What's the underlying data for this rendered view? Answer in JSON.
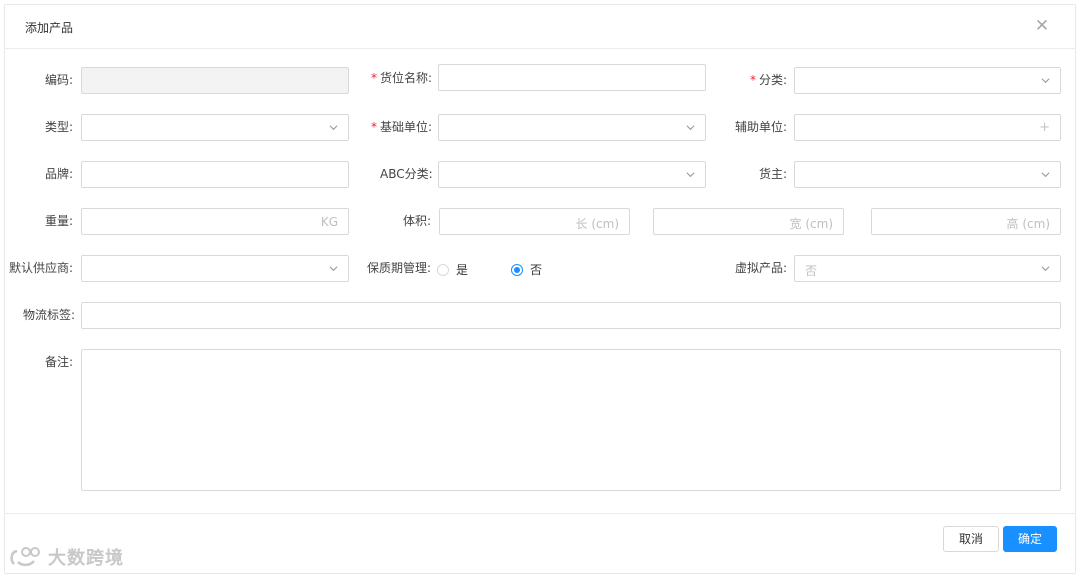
{
  "modal": {
    "title": "添加产品",
    "close_icon": "close-icon"
  },
  "form": {
    "code": {
      "label": "编码:",
      "value": ""
    },
    "location_name": {
      "label": "货位名称:",
      "required": true,
      "value": ""
    },
    "category": {
      "label": "分类:",
      "required": true,
      "value": ""
    },
    "type": {
      "label": "类型:",
      "value": ""
    },
    "base_unit": {
      "label": "基础单位:",
      "required": true,
      "value": ""
    },
    "aux_unit": {
      "label": "辅助单位:",
      "value": "",
      "icon": "plus-icon"
    },
    "brand": {
      "label": "品牌:",
      "value": ""
    },
    "abc_category": {
      "label": "ABC分类:",
      "value": ""
    },
    "owner": {
      "label": "货主:",
      "value": ""
    },
    "weight": {
      "label": "重量:",
      "unit": "KG",
      "value": ""
    },
    "volume": {
      "label": "体积:",
      "length_placeholder": "长 (cm)",
      "width_placeholder": "宽 (cm)",
      "height_placeholder": "高 (cm)"
    },
    "default_supplier": {
      "label": "默认供应商:",
      "value": ""
    },
    "shelf_life": {
      "label": "保质期管理:",
      "options": [
        "是",
        "否"
      ],
      "selected": "否"
    },
    "virtual_product": {
      "label": "虚拟产品:",
      "value": "否"
    },
    "logistics_tag": {
      "label": "物流标签:",
      "value": ""
    },
    "remark": {
      "label": "备注:",
      "value": ""
    }
  },
  "footer": {
    "cancel_label": "取消",
    "ok_label": "确定"
  },
  "watermark": {
    "text": "大数跨境",
    "icon": "logo-icon"
  },
  "colors": {
    "primary": "#1890ff",
    "required": "#f5222d",
    "border": "#d9d9d9",
    "disabled_bg": "#f3f3f3"
  }
}
